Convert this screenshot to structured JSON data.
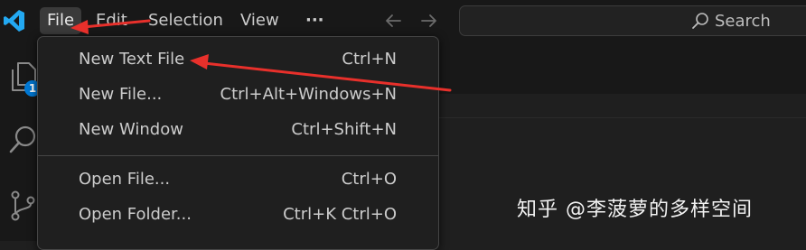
{
  "menubar": {
    "items": [
      {
        "label": "File",
        "active": true
      },
      {
        "label": "Edit",
        "active": false
      },
      {
        "label": "Selection",
        "active": false
      },
      {
        "label": "View",
        "active": false
      }
    ],
    "more_label": "···"
  },
  "search": {
    "label": "Search",
    "icon": "search-icon"
  },
  "activity_bar": {
    "explorer_badge": "1"
  },
  "file_menu": {
    "groups": [
      [
        {
          "label": "New Text File",
          "shortcut": "Ctrl+N"
        },
        {
          "label": "New File...",
          "shortcut": "Ctrl+Alt+Windows+N"
        },
        {
          "label": "New Window",
          "shortcut": "Ctrl+Shift+N"
        }
      ],
      [
        {
          "label": "Open File...",
          "shortcut": "Ctrl+O"
        },
        {
          "label": "Open Folder...",
          "shortcut": "Ctrl+K Ctrl+O"
        }
      ]
    ]
  },
  "watermark": "知乎 @李菠萝的多样空间",
  "colors": {
    "annotation_arrow": "#e8302b",
    "logo_blue": "#23a9f2",
    "badge_blue": "#0078d4"
  }
}
